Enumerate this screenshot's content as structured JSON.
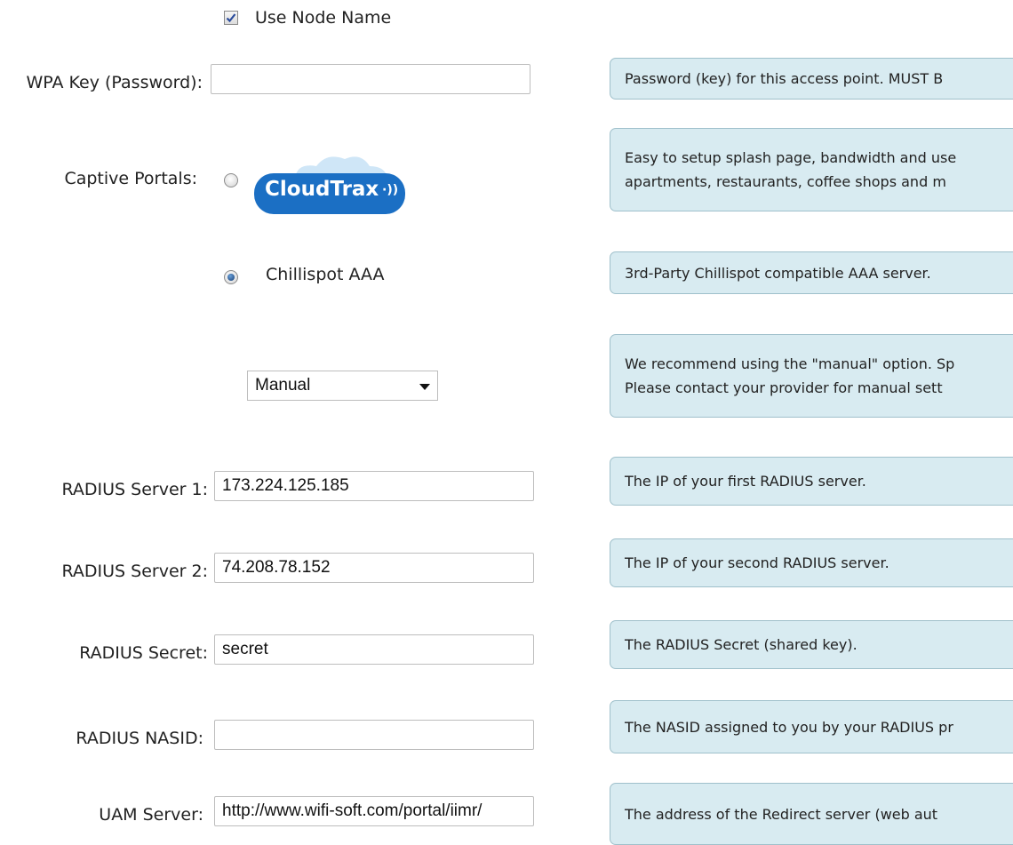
{
  "use_node_name": {
    "label": "Use Node Name",
    "checked": true
  },
  "wpa_key": {
    "label": "WPA Key (Password):",
    "value": ""
  },
  "captive_portals": {
    "label": "Captive Portals:",
    "cloudtrax_logo_text": "CloudTrax",
    "chillispot_label": "Chillispot AAA",
    "selected": "Chillispot AAA"
  },
  "mode_select": {
    "value": "Manual"
  },
  "radius_server_1": {
    "label": "RADIUS Server 1:",
    "value": "173.224.125.185"
  },
  "radius_server_2": {
    "label": "RADIUS Server 2:",
    "value": "74.208.78.152"
  },
  "radius_secret": {
    "label": "RADIUS Secret:",
    "value": "secret"
  },
  "radius_nasid": {
    "label": "RADIUS NASID:",
    "value": ""
  },
  "uam_server": {
    "label": "UAM Server:",
    "value": "http://www.wifi-soft.com/portal/iimr/"
  },
  "help": {
    "wpa_key": [
      "Password (key) for this access point. MUST B"
    ],
    "cloudtrax": [
      "Easy to setup splash page, bandwidth and use",
      "apartments, restaurants, coffee shops and m"
    ],
    "chillispot": [
      "3rd-Party Chillispot compatible AAA server."
    ],
    "manual": [
      "We recommend using the \"manual\" option. Sp",
      "Please contact your provider for manual sett"
    ],
    "radius_server_1": [
      "The IP of your first RADIUS server."
    ],
    "radius_server_2": [
      "The IP of your second RADIUS server."
    ],
    "radius_secret": [
      "The RADIUS Secret (shared key)."
    ],
    "radius_nasid": [
      "The NASID assigned to you by your RADIUS pr"
    ],
    "uam_server": [
      "The address of the Redirect server (web aut"
    ]
  },
  "colors": {
    "help_bg": "#d8ebf1",
    "help_border": "#9fc0cb",
    "cloudtrax_blue": "#1b6fc4",
    "sun": "#f6b333"
  }
}
